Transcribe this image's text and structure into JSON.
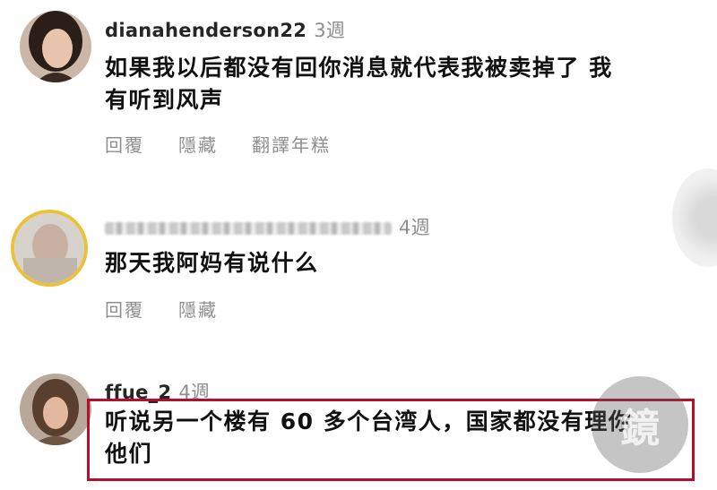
{
  "comments": [
    {
      "username": "dianahenderson22",
      "age": "3週",
      "text_lines": [
        "如果我以后都没有回你消息就代表我被卖掉了  我",
        "有听到风声"
      ],
      "actions": [
        "回覆",
        "隱藏",
        "翻譯年糕"
      ]
    },
    {
      "username": "",
      "age": "4週",
      "text_lines": [
        "那天我阿妈有说什么"
      ],
      "actions": [
        "回覆",
        "隱藏"
      ]
    },
    {
      "username": "ffue_2",
      "age": "4週",
      "text_lines": [
        "听说另一个楼有 60 多个台湾人，国家都没有理你",
        "他们"
      ]
    }
  ],
  "watermark": {
    "label": "鏡",
    "icon": "mirror-media-logo"
  },
  "colors": {
    "highlight_border": "#b3112b",
    "secondary_text": "#8e8e8e"
  }
}
